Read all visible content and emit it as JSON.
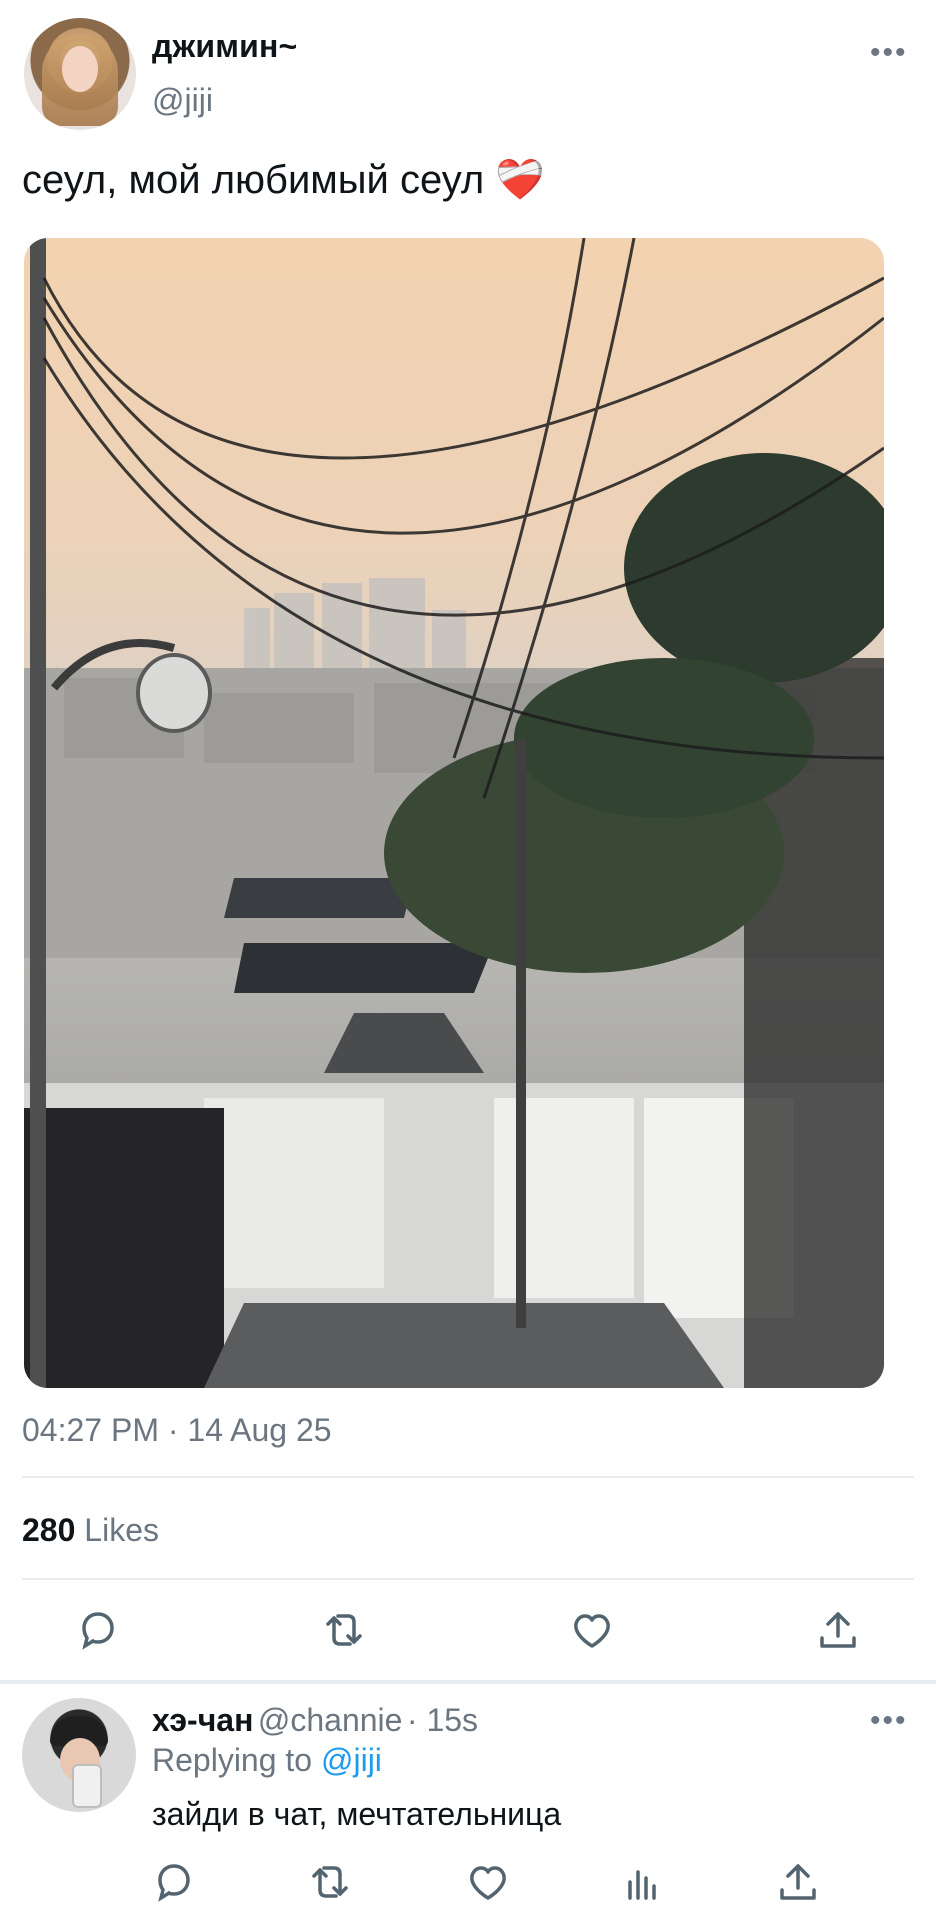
{
  "tweet": {
    "author": {
      "display_name": "джимин~",
      "handle": "@jiji"
    },
    "more_label": "•••",
    "text": "сеул, мой любимый сеул ❤️‍🩹",
    "timestamp": "04:27 PM · 14 Aug 25",
    "likes": {
      "count": "280",
      "label": "Likes"
    },
    "actions": [
      "reply-icon",
      "retweet-icon",
      "like-icon",
      "share-icon"
    ]
  },
  "reply": {
    "author": {
      "display_name": "хэ-чан",
      "handle": "@channie",
      "time": "· 15s"
    },
    "replying_to_prefix": "Replying to",
    "replying_to_handle": "@jiji",
    "more_label": "•••",
    "text": "зайди в чат, мечтательница",
    "actions": [
      "reply-icon",
      "retweet-icon",
      "like-icon",
      "views-icon",
      "share-icon"
    ]
  },
  "colors": {
    "text": "#0f1419",
    "secondary": "#6b7680",
    "link": "#1d9bf0",
    "divider": "#e6ecf0"
  }
}
